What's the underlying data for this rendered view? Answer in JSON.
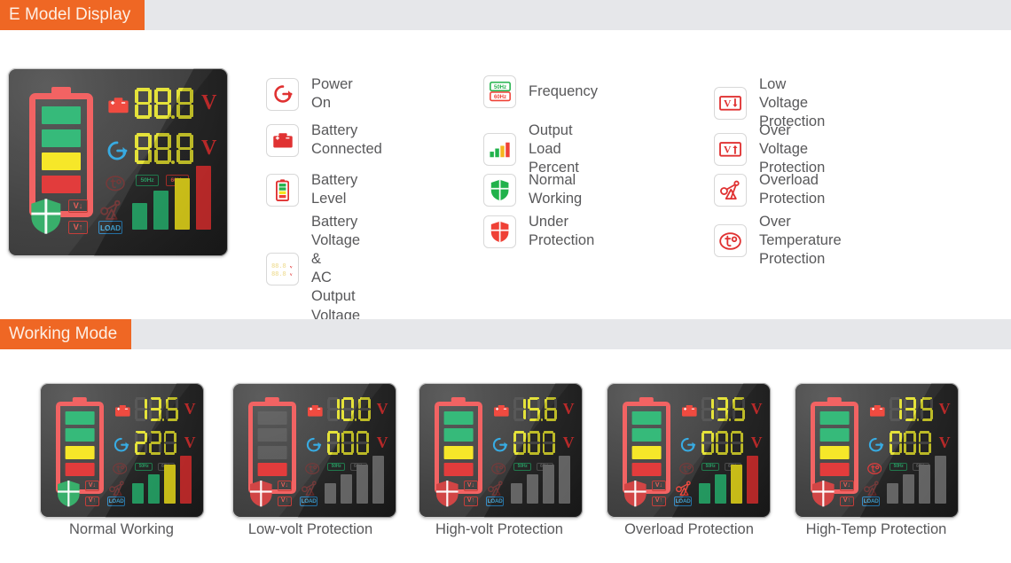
{
  "sections": {
    "display": {
      "title": "E Model Display"
    },
    "working": {
      "title": "Working Mode"
    }
  },
  "colors": {
    "accent": "#ef6724",
    "header_band": "#e6e7ea",
    "panel_dark": "#2c2c2c",
    "segment_on": "#e3e02f",
    "segment_off": "#4f4f4f",
    "red": "#e03232",
    "green": "#2bb673",
    "yellow": "#f5e61e",
    "blue": "#2da7e0",
    "text": "#58585a"
  },
  "main_display": {
    "battery_voltage": "88.8",
    "output_voltage": "88.8",
    "volt_unit_top": "V",
    "volt_unit_bottom": "V",
    "freq_50": "50Hz",
    "freq_60": "60Hz",
    "load_badge": "LOAD",
    "v_down_badge": "V",
    "v_up_badge": "V",
    "battery_segments": [
      "green",
      "green",
      "yellow",
      "red"
    ],
    "load_bars": [
      "green",
      "green",
      "yellow",
      "red"
    ]
  },
  "legend": {
    "columns": [
      {
        "items": [
          {
            "label": "Power On",
            "icon": "power-on-icon"
          },
          {
            "label": "Battery Connected",
            "icon": "battery-connected-icon"
          },
          {
            "label": "Battery Level",
            "icon": "battery-level-icon"
          },
          {
            "label": "Battery Voltage &\nAC Output Voltage",
            "icon": "voltage-readout-icon"
          }
        ]
      },
      {
        "items": [
          {
            "label": "Frequency",
            "icon": "frequency-icon"
          },
          {
            "label": "Output Load Percent",
            "icon": "output-load-percent-icon"
          },
          {
            "label": "Normal Working",
            "icon": "normal-working-shield-icon"
          },
          {
            "label": "Under Protection",
            "icon": "under-protection-shield-icon"
          }
        ]
      },
      {
        "items": [
          {
            "label": "Low Voltage Protection",
            "icon": "low-voltage-icon"
          },
          {
            "label": "Over Voltage Protection",
            "icon": "over-voltage-icon"
          },
          {
            "label": "Overload Protection",
            "icon": "overload-icon"
          },
          {
            "label": "Over Temperature Protection",
            "icon": "over-temperature-icon"
          }
        ]
      }
    ]
  },
  "working_modes": [
    {
      "caption": "Normal Working",
      "battery_voltage": "13.5",
      "output_voltage": "220",
      "battery_segments": [
        "green",
        "green",
        "yellow",
        "red"
      ],
      "load_bars": [
        "green",
        "green",
        "yellow",
        "red"
      ],
      "shield": "green",
      "freq_50_active": true,
      "freq_60_active": false,
      "battery_outline_active": true,
      "power_icon_active": true,
      "battery_icon_active": true,
      "temp_icon_active": false,
      "overload_icon_active": false,
      "load_badge_active": true
    },
    {
      "caption": "Low-volt Protection",
      "battery_voltage": "10.0",
      "output_voltage": "000",
      "battery_segments": [
        "off",
        "off",
        "off",
        "red"
      ],
      "load_bars": [
        "off",
        "off",
        "off",
        "off"
      ],
      "shield": "red",
      "freq_50_active": true,
      "freq_60_active": false,
      "battery_outline_active": true,
      "power_icon_active": true,
      "battery_icon_active": true,
      "temp_icon_active": false,
      "overload_icon_active": false,
      "load_badge_active": true
    },
    {
      "caption": "High-volt Protection",
      "battery_voltage": "15.6",
      "output_voltage": "000",
      "battery_segments": [
        "green",
        "green",
        "yellow",
        "red"
      ],
      "load_bars": [
        "off",
        "off",
        "off",
        "off"
      ],
      "shield": "red",
      "freq_50_active": true,
      "freq_60_active": false,
      "battery_outline_active": true,
      "power_icon_active": true,
      "battery_icon_active": true,
      "temp_icon_active": false,
      "overload_icon_active": false,
      "load_badge_active": true
    },
    {
      "caption": "Overload Protection",
      "battery_voltage": "13.5",
      "output_voltage": "000",
      "battery_segments": [
        "green",
        "green",
        "yellow",
        "red"
      ],
      "load_bars": [
        "green",
        "green",
        "yellow",
        "red"
      ],
      "shield": "red",
      "freq_50_active": true,
      "freq_60_active": false,
      "battery_outline_active": true,
      "power_icon_active": true,
      "battery_icon_active": true,
      "temp_icon_active": false,
      "overload_icon_active": true,
      "load_badge_active": true
    },
    {
      "caption": "High-Temp Protection",
      "battery_voltage": "13.5",
      "output_voltage": "000",
      "battery_segments": [
        "green",
        "green",
        "yellow",
        "red"
      ],
      "load_bars": [
        "off",
        "off",
        "off",
        "off"
      ],
      "shield": "red",
      "freq_50_active": true,
      "freq_60_active": false,
      "battery_outline_active": true,
      "power_icon_active": true,
      "battery_icon_active": true,
      "temp_icon_active": true,
      "overload_icon_active": false,
      "load_badge_active": true
    }
  ]
}
